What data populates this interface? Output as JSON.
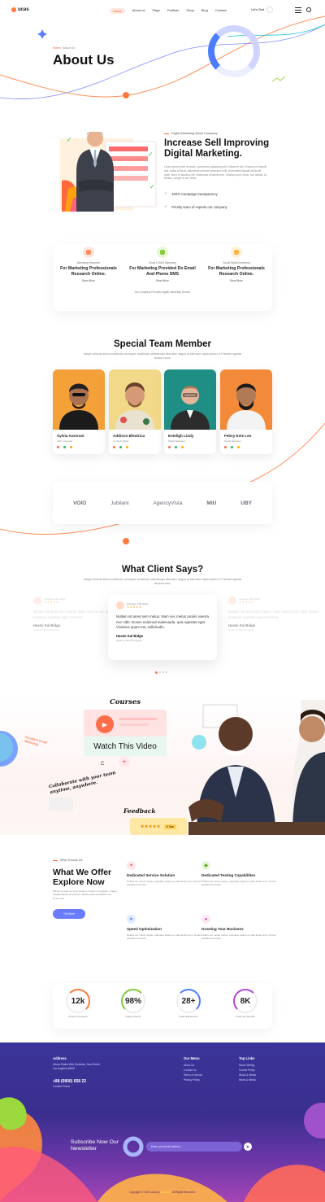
{
  "brand": {
    "name": "ucas"
  },
  "nav": {
    "items": [
      "Home",
      "About us",
      "Page",
      "Portfolio",
      "Shop",
      "Blog",
      "Contact"
    ],
    "active": "Home",
    "chat": "Let's Chat"
  },
  "hero": {
    "crumb_home": "Home",
    "crumb_current": "About Us",
    "title": "About Us"
  },
  "intro": {
    "tag": "Digital Marketing About Company",
    "title": "Increase Sell Improving Digital Marketing.",
    "body": "Lorem ipsum dolor sit amet, consectetur adipiscing elit. Nullam et nisi. Vivamus mi blandit sed, mollis id fabus. Maecenas pulvinar bibendum velit, et hendrerit blandit mollis elit amet. Nunc et faucibus elit. Maecenas id lacinia felis. Vivamus proin Nunc, non lacinia. Ut Nullam. Integer et dui Tellus.",
    "checks": [
      "100% Campaign transparency",
      "Priority team of experts our company"
    ]
  },
  "services": {
    "items": [
      {
        "label": "Marketing Research",
        "title": "For Marketing Professionals Research Online.",
        "more": "Read More"
      },
      {
        "label": "Email & SMS Marketing",
        "title": "For Marketing Provided Do Email And Phone SMS",
        "more": "Read More"
      },
      {
        "label": "Social Media Marketing",
        "title": "For Marketing Professionals Research Online.",
        "more": "Read More"
      }
    ],
    "note": "Our Company Provides digital marketing Service"
  },
  "team": {
    "title": "Special Team Member",
    "sub": "Integer vehicula dictum sollicitudin consequat. Vestibulum pellentesque bibendum magna, at bibendum turpis lacinia Ut. Praesent egestas tincidunt risus.",
    "members": [
      {
        "name": "Sylvia Aurorani",
        "role": "CEO, Founder"
      },
      {
        "name": "Addison Bleatrica",
        "role": "Content Writer"
      },
      {
        "name": "Esteligh Lindy",
        "role": "Digital Marketer"
      },
      {
        "name": "Febsy Evie Leo",
        "role": "Social Marketer"
      }
    ]
  },
  "brands": [
    "VOIO",
    "Jubilant",
    "AgencyVista",
    "MIU",
    "UBY"
  ],
  "testimonials": {
    "title": "What Client Says?",
    "sub": "Integer vehicula dictum sollicitudin consequat. Vestibulum pellentesque bibendum magna, at bibendum turpis lacinia Ut. Praesent egestas tincidunt risus.",
    "items": [
      {
        "rating": "Average 4.98 rating",
        "text": "Nullam sit amet sem metus. Nam viverra nec nibh. Donec euismod egestas eget Vivamus.",
        "name": "Hasmi Kal Bidge",
        "role": "Head of UI/UX Designer"
      },
      {
        "rating": "Average 4.98 rating",
        "text": "Nullam sit amet sem metus. Nam nec metus iaculis viverra nec nibh. Donec euismod malesuada, quis egestas eget. Vivamus quam est, sollicitudin.",
        "name": "Hasmi Kal Bidge",
        "role": "Head of UI/UX Designer"
      },
      {
        "rating": "Average 4.98 rating",
        "text": "Nullam sit amet sem metus. Nam viverra nec nibh. Donec euismod egestas eget Vivamus.",
        "name": "Hasmi Kal Bidge",
        "role": "Head of UI/UX Designer"
      }
    ]
  },
  "video": {
    "courses": "Courses",
    "watch": "Watch This Video",
    "marketing": "Excellent Email Marketing",
    "collab": "Collaborate with your team anytime, anywhere.",
    "feedback": "Feedback",
    "badge": "5 Star"
  },
  "why": {
    "tag": "Why Choose Us",
    "title": "What We Offer Explore Now",
    "body": "Mauris et dolor ac risus pretium congue in est diam. Integer fringilla sapien ac pretium. Mauris placerat efficitur nisi luctus sed.",
    "btn": "Get More",
    "features": [
      {
        "title": "Dedicated Service Solution",
        "desc": "Nullam vel metus metus, vulputate sapien et vitae luctus arcu. Donec gravida commodo."
      },
      {
        "title": "Dedicated Testing Capabilities",
        "desc": "Nullam vel metus metus, vulputate sapien et vitae luctus arcu. Donec gravida commodo."
      },
      {
        "title": "Speed Optimization",
        "desc": "Nullam vel metus metus, vulputate sapien et vitae luctus arcu. Donec gravida commodo."
      },
      {
        "title": "Growing Your Business",
        "desc": "Nullam vel metus metus, vulputate sapien et vitae luctus arcu. Donec gravida commodo."
      }
    ]
  },
  "stats": [
    {
      "value": "12k",
      "label": "Project Complete"
    },
    {
      "value": "98%",
      "label": "Happy Clients"
    },
    {
      "value": "28+",
      "label": "Years Experience"
    },
    {
      "value": "8K",
      "label": "Customer Review"
    }
  ],
  "footer": {
    "address_h": "Address",
    "address": "Uttara Dhaka Web Websites, New Street Los Angeles 98000",
    "phone": "+88 (0800) 658 22",
    "phone_sub": "Contact Phone",
    "menu_h": "Our Menu",
    "menu": [
      "About Us",
      "Contact Us",
      "Terms of service",
      "Privacy Policy"
    ],
    "links_h": "Top Links",
    "links": [
      "Name Writing",
      "Course Policy",
      "About & Media",
      "News & Media"
    ],
    "subscribe": "Subscribe Now Our Newsletter",
    "email_ph": "Enter your email address...",
    "copyright": "Copyright © 2022 Ucas by",
    "company": "company",
    "rights": ". All Rights Reserved."
  }
}
